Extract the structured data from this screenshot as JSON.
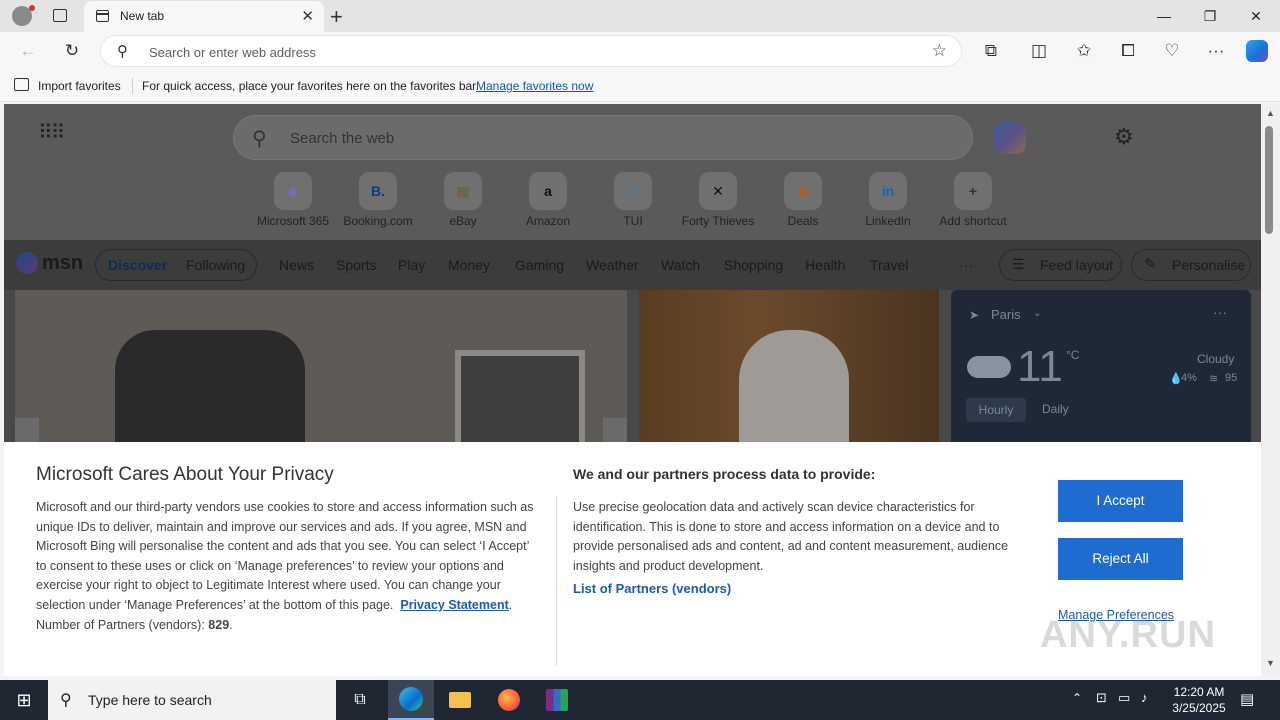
{
  "browser": {
    "tab_title": "New tab",
    "address_placeholder": "Search or enter web address"
  },
  "favorites_bar": {
    "import_label": "Import favorites",
    "hint_text": "For quick access, place your favorites here on the favorites bar.",
    "manage_link": "Manage favorites now"
  },
  "newtab": {
    "search_placeholder": "Search the web",
    "shortcuts": [
      {
        "label": "Microsoft 365",
        "glyph": "◈",
        "color": "#7b6cc7"
      },
      {
        "label": "Booking.com",
        "glyph": "B.",
        "color": "#0c3b8a"
      },
      {
        "label": "eBay",
        "glyph": "▦",
        "color": "#7a5a2b"
      },
      {
        "label": "Amazon",
        "glyph": "a",
        "color": "#111111"
      },
      {
        "label": "TUI",
        "glyph": "☺",
        "color": "#3b82c4"
      },
      {
        "label": "Forty Thieves",
        "glyph": "✕",
        "color": "#111111"
      },
      {
        "label": "Deals",
        "glyph": "◆",
        "color": "#b35a1f"
      },
      {
        "label": "LinkedIn",
        "glyph": "in",
        "color": "#0a66c2"
      },
      {
        "label": "Add shortcut",
        "glyph": "+",
        "color": "#333333"
      }
    ]
  },
  "msn": {
    "brand": "msn",
    "tabs": [
      {
        "label": "Discover"
      },
      {
        "label": "Following"
      }
    ],
    "nav": [
      "News",
      "Sports",
      "Play",
      "Money",
      "Gaming",
      "Weather",
      "Watch",
      "Shopping",
      "Health",
      "Travel"
    ],
    "more": "···",
    "feed_layout": "Feed layout",
    "personalise": "Personalise"
  },
  "weather": {
    "city": "Paris",
    "temp": "11",
    "unit": "°C",
    "condition": "Cloudy",
    "precip": "4%",
    "humidity": "95",
    "tab_hourly": "Hourly",
    "tab_daily": "Daily"
  },
  "privacy": {
    "title": "Microsoft Cares About Your Privacy",
    "body": "Microsoft and our third-party vendors use cookies to store and access information such as unique IDs to deliver, maintain and improve our services and ads. If you agree, MSN and Microsoft Bing will personalise the content and ads that you see. You can select ‘I Accept’ to consent to these uses or click on ‘Manage preferences’ to review your options and exercise your right to object to Legitimate Interest where used.  You can change your selection under ‘Manage Preferences’ at the bottom of this page.",
    "privacy_link": "Privacy Statement",
    "partners_label": "Number of Partners (vendors):",
    "partners_count": "829",
    "right_title": "We and our partners process data to provide:",
    "right_body": "Use precise geolocation data and actively scan device characteristics for identification. This is done to store and access information on a device and to provide personalised ads and content, ad and content measurement, audience insights and product development.",
    "partners_link": "List of Partners (vendors)",
    "accept": "I Accept",
    "reject": "Reject All",
    "manage": "Manage Preferences"
  },
  "watermark": "ANY.RUN",
  "taskbar": {
    "search_placeholder": "Type here to search",
    "time": "12:20 AM",
    "date": "3/25/2025"
  }
}
